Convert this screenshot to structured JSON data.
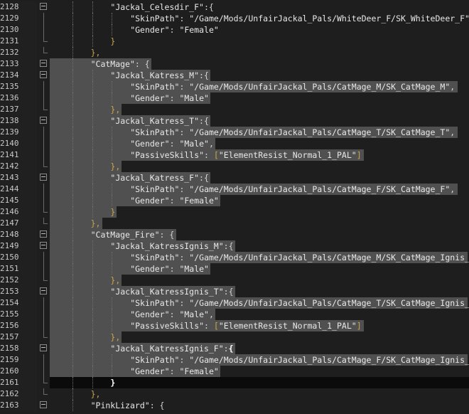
{
  "editor": {
    "lines": [
      {
        "num": "2128",
        "indent": 3,
        "tokens": [
          {
            "t": "\"Jackal_Celesdir_F\"",
            "c": "s"
          },
          {
            "t": ":{",
            "c": "p"
          }
        ],
        "fold": "open",
        "sel": false
      },
      {
        "num": "2129",
        "indent": 4,
        "tokens": [
          {
            "t": "\"SkinPath\"",
            "c": "s"
          },
          {
            "t": ": ",
            "c": "p"
          },
          {
            "t": "\"/Game/Mods/UnfairJackal_Pals/WhiteDeer_F/SK_WhiteDeer_F\"",
            "c": "s"
          },
          {
            "t": ",",
            "c": "p"
          }
        ],
        "fold": "line",
        "sel": false
      },
      {
        "num": "2130",
        "indent": 4,
        "tokens": [
          {
            "t": "\"Gender\"",
            "c": "s"
          },
          {
            "t": ": ",
            "c": "p"
          },
          {
            "t": "\"Female\"",
            "c": "s"
          }
        ],
        "fold": "line",
        "sel": false
      },
      {
        "num": "2131",
        "indent": 3,
        "tokens": [
          {
            "t": "}",
            "c": "bracket"
          }
        ],
        "fold": "end",
        "sel": false
      },
      {
        "num": "2132",
        "indent": 2,
        "tokens": [
          {
            "t": "},",
            "c": "bracket"
          }
        ],
        "fold": "end",
        "sel": false
      },
      {
        "num": "2133",
        "indent": 2,
        "tokens": [
          {
            "t": "\"CatMage\"",
            "c": "s"
          },
          {
            "t": ": {",
            "c": "p"
          }
        ],
        "fold": "open",
        "sel": true
      },
      {
        "num": "2134",
        "indent": 3,
        "tokens": [
          {
            "t": "\"Jackal_Katress_M\"",
            "c": "s"
          },
          {
            "t": ":{",
            "c": "p"
          }
        ],
        "fold": "open",
        "sel": true
      },
      {
        "num": "2135",
        "indent": 4,
        "tokens": [
          {
            "t": "\"SkinPath\"",
            "c": "s"
          },
          {
            "t": ": ",
            "c": "p"
          },
          {
            "t": "\"/Game/Mods/UnfairJackal_Pals/CatMage_M/SK_CatMage_M\"",
            "c": "s"
          },
          {
            "t": ",",
            "c": "p"
          }
        ],
        "fold": "line",
        "sel": true
      },
      {
        "num": "2136",
        "indent": 4,
        "tokens": [
          {
            "t": "\"Gender\"",
            "c": "s"
          },
          {
            "t": ": ",
            "c": "p"
          },
          {
            "t": "\"Male\"",
            "c": "s"
          }
        ],
        "fold": "line",
        "sel": true
      },
      {
        "num": "2137",
        "indent": 3,
        "tokens": [
          {
            "t": "},",
            "c": "bracket"
          }
        ],
        "fold": "end",
        "sel": true
      },
      {
        "num": "2138",
        "indent": 3,
        "tokens": [
          {
            "t": "\"Jackal_Katress_T\"",
            "c": "s"
          },
          {
            "t": ":{",
            "c": "p"
          }
        ],
        "fold": "open",
        "sel": true
      },
      {
        "num": "2139",
        "indent": 4,
        "tokens": [
          {
            "t": "\"SkinPath\"",
            "c": "s"
          },
          {
            "t": ": ",
            "c": "p"
          },
          {
            "t": "\"/Game/Mods/UnfairJackal_Pals/CatMage_T/SK_CatMage_T\"",
            "c": "s"
          },
          {
            "t": ",",
            "c": "p"
          }
        ],
        "fold": "line",
        "sel": true
      },
      {
        "num": "2140",
        "indent": 4,
        "tokens": [
          {
            "t": "\"Gender\"",
            "c": "s"
          },
          {
            "t": ": ",
            "c": "p"
          },
          {
            "t": "\"Male\"",
            "c": "s"
          },
          {
            "t": ",",
            "c": "p"
          }
        ],
        "fold": "line",
        "sel": true
      },
      {
        "num": "2141",
        "indent": 4,
        "tokens": [
          {
            "t": "\"PassiveSkills\"",
            "c": "s"
          },
          {
            "t": ": ",
            "c": "p"
          },
          {
            "t": "[",
            "c": "bracket"
          },
          {
            "t": "\"ElementResist_Normal_1_PAL\"",
            "c": "s"
          },
          {
            "t": "]",
            "c": "bracket"
          }
        ],
        "fold": "line",
        "sel": true
      },
      {
        "num": "2142",
        "indent": 3,
        "tokens": [
          {
            "t": "},",
            "c": "bracket"
          }
        ],
        "fold": "end",
        "sel": true
      },
      {
        "num": "2143",
        "indent": 3,
        "tokens": [
          {
            "t": "\"Jackal_Katress_F\"",
            "c": "s"
          },
          {
            "t": ":{",
            "c": "p"
          }
        ],
        "fold": "open",
        "sel": true
      },
      {
        "num": "2144",
        "indent": 4,
        "tokens": [
          {
            "t": "\"SkinPath\"",
            "c": "s"
          },
          {
            "t": ": ",
            "c": "p"
          },
          {
            "t": "\"/Game/Mods/UnfairJackal_Pals/CatMage_F/SK_CatMage_F\"",
            "c": "s"
          },
          {
            "t": ",",
            "c": "p"
          }
        ],
        "fold": "line",
        "sel": true
      },
      {
        "num": "2145",
        "indent": 4,
        "tokens": [
          {
            "t": "\"Gender\"",
            "c": "s"
          },
          {
            "t": ": ",
            "c": "p"
          },
          {
            "t": "\"Female\"",
            "c": "s"
          }
        ],
        "fold": "line",
        "sel": true
      },
      {
        "num": "2146",
        "indent": 3,
        "tokens": [
          {
            "t": "}",
            "c": "bracket"
          }
        ],
        "fold": "end",
        "sel": true
      },
      {
        "num": "2147",
        "indent": 2,
        "tokens": [
          {
            "t": "},",
            "c": "bracket"
          }
        ],
        "fold": "end",
        "sel": true
      },
      {
        "num": "2148",
        "indent": 2,
        "tokens": [
          {
            "t": "\"CatMage_Fire\"",
            "c": "s"
          },
          {
            "t": ": {",
            "c": "p"
          }
        ],
        "fold": "open",
        "sel": true
      },
      {
        "num": "2149",
        "indent": 3,
        "tokens": [
          {
            "t": "\"Jackal_KatressIgnis_M\"",
            "c": "s"
          },
          {
            "t": ":{",
            "c": "p"
          }
        ],
        "fold": "open",
        "sel": true
      },
      {
        "num": "2150",
        "indent": 4,
        "tokens": [
          {
            "t": "\"SkinPath\"",
            "c": "s"
          },
          {
            "t": ": ",
            "c": "p"
          },
          {
            "t": "\"/Game/Mods/UnfairJackal_Pals/CatMage_M/SK_CatMage_Ignis_M\"",
            "c": "s"
          },
          {
            "t": ",",
            "c": "p"
          }
        ],
        "fold": "line",
        "sel": true
      },
      {
        "num": "2151",
        "indent": 4,
        "tokens": [
          {
            "t": "\"Gender\"",
            "c": "s"
          },
          {
            "t": ": ",
            "c": "p"
          },
          {
            "t": "\"Male\"",
            "c": "s"
          }
        ],
        "fold": "line",
        "sel": true
      },
      {
        "num": "2152",
        "indent": 3,
        "tokens": [
          {
            "t": "},",
            "c": "bracket"
          }
        ],
        "fold": "end",
        "sel": true
      },
      {
        "num": "2153",
        "indent": 3,
        "tokens": [
          {
            "t": "\"Jackal_KatressIgnis_T\"",
            "c": "s"
          },
          {
            "t": ":{",
            "c": "p"
          }
        ],
        "fold": "open",
        "sel": true
      },
      {
        "num": "2154",
        "indent": 4,
        "tokens": [
          {
            "t": "\"SkinPath\"",
            "c": "s"
          },
          {
            "t": ": ",
            "c": "p"
          },
          {
            "t": "\"/Game/Mods/UnfairJackal_Pals/CatMage_T/SK_CatMage_Ignis_T\"",
            "c": "s"
          },
          {
            "t": ",",
            "c": "p"
          }
        ],
        "fold": "line",
        "sel": true
      },
      {
        "num": "2155",
        "indent": 4,
        "tokens": [
          {
            "t": "\"Gender\"",
            "c": "s"
          },
          {
            "t": ": ",
            "c": "p"
          },
          {
            "t": "\"Male\"",
            "c": "s"
          },
          {
            "t": ",",
            "c": "p"
          }
        ],
        "fold": "line",
        "sel": true
      },
      {
        "num": "2156",
        "indent": 4,
        "tokens": [
          {
            "t": "\"PassiveSkills\"",
            "c": "s"
          },
          {
            "t": ": ",
            "c": "p"
          },
          {
            "t": "[",
            "c": "bracket"
          },
          {
            "t": "\"ElementResist_Normal_1_PAL\"",
            "c": "s"
          },
          {
            "t": "]",
            "c": "bracket"
          }
        ],
        "fold": "line",
        "sel": true
      },
      {
        "num": "2157",
        "indent": 3,
        "tokens": [
          {
            "t": "},",
            "c": "bracket"
          }
        ],
        "fold": "end",
        "sel": true
      },
      {
        "num": "2158",
        "indent": 3,
        "tokens": [
          {
            "t": "\"Jackal_KatressIgnis_F\"",
            "c": "s"
          },
          {
            "t": ":",
            "c": "p"
          },
          {
            "t": "{",
            "c": "bracket-hi"
          }
        ],
        "fold": "open",
        "sel": true
      },
      {
        "num": "2159",
        "indent": 4,
        "tokens": [
          {
            "t": "\"SkinPath\"",
            "c": "s"
          },
          {
            "t": ": ",
            "c": "p"
          },
          {
            "t": "\"/Game/Mods/UnfairJackal_Pals/CatMage_F/SK_CatMage_Ignis_F\"",
            "c": "s"
          },
          {
            "t": ",",
            "c": "p"
          }
        ],
        "fold": "line",
        "sel": true
      },
      {
        "num": "2160",
        "indent": 4,
        "tokens": [
          {
            "t": "\"Gender\"",
            "c": "s"
          },
          {
            "t": ": ",
            "c": "p"
          },
          {
            "t": "\"Female\"",
            "c": "s"
          }
        ],
        "fold": "line",
        "sel": true
      },
      {
        "num": "2161",
        "indent": 3,
        "tokens": [
          {
            "t": "}",
            "c": "bracket-hi"
          }
        ],
        "fold": "end",
        "sel": false,
        "current": true
      },
      {
        "num": "2162",
        "indent": 2,
        "tokens": [
          {
            "t": "},",
            "c": "bracket"
          }
        ],
        "fold": "end",
        "sel": false
      },
      {
        "num": "2163",
        "indent": 2,
        "tokens": [
          {
            "t": "\"PinkLizard\"",
            "c": "s"
          },
          {
            "t": ": {",
            "c": "p"
          }
        ],
        "fold": "open",
        "sel": false
      }
    ]
  }
}
